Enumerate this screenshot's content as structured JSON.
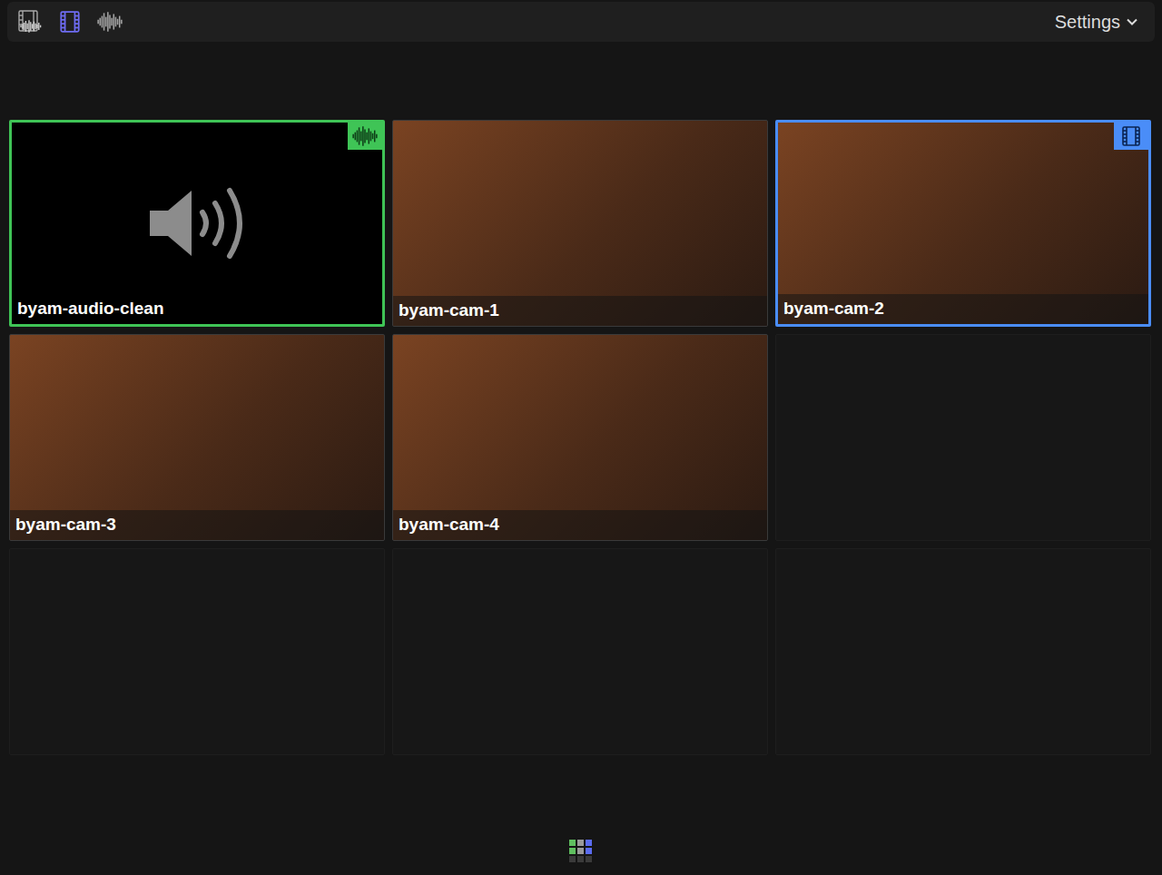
{
  "toolbar": {
    "modes": [
      {
        "kind": "audio-video",
        "selected": false
      },
      {
        "kind": "video",
        "selected": true
      },
      {
        "kind": "audio",
        "selected": false
      }
    ],
    "settings": {
      "label": "Settings"
    }
  },
  "angles": [
    {
      "kind": "audio",
      "name": "byam-audio-clean",
      "audio_active": true,
      "video_active": false
    },
    {
      "kind": "video",
      "name": "byam-cam-1",
      "audio_active": false,
      "video_active": false
    },
    {
      "kind": "video",
      "name": "byam-cam-2",
      "audio_active": false,
      "video_active": true
    },
    {
      "kind": "video",
      "name": "byam-cam-3",
      "audio_active": false,
      "video_active": false
    },
    {
      "kind": "video",
      "name": "byam-cam-4",
      "audio_active": false,
      "video_active": false
    },
    {
      "kind": "empty"
    },
    {
      "kind": "empty"
    },
    {
      "kind": "empty"
    },
    {
      "kind": "empty"
    }
  ]
}
